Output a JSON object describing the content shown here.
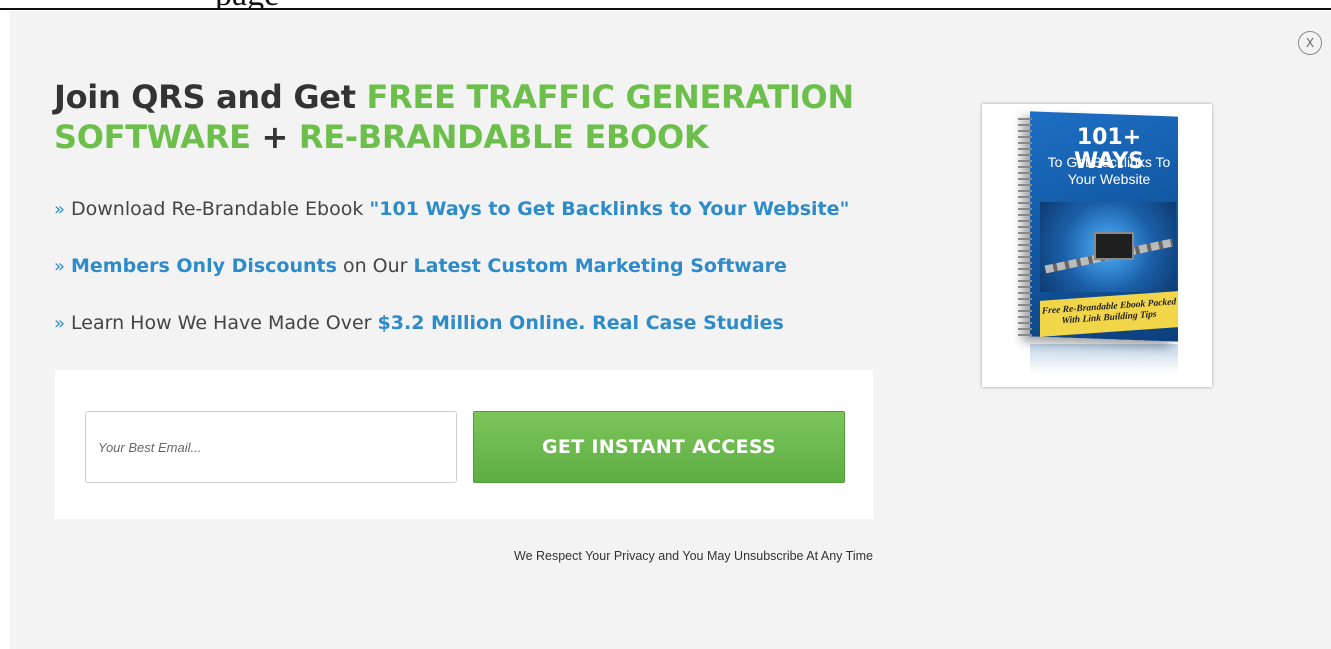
{
  "background": {
    "partial_text": "                                   page"
  },
  "popup": {
    "close_label": "X",
    "headline": {
      "part1": "Join QRS and Get ",
      "part2": "FREE TRAFFIC GENERATION SOFTWARE",
      "part3": " + ",
      "part4": "RE-BRANDABLE EBOOK"
    },
    "bullets": [
      {
        "arrow": "»",
        "pre": "Download Re-Brandable Ebook ",
        "highlight": "\"101 Ways to Get Backlinks to Your Website\"",
        "post": ""
      },
      {
        "arrow": "»",
        "pre": "",
        "highlight": "Members Only Discounts",
        "mid": " on Our ",
        "highlight2": "Latest Custom Marketing Software"
      },
      {
        "arrow": "»",
        "pre": "Learn How We Have Made Over ",
        "highlight": "$3.2 Million Online. Real Case Studies",
        "post": ""
      }
    ],
    "form": {
      "email_placeholder": "Your Best Email...",
      "email_value": "",
      "submit_label": "GET INSTANT ACCESS"
    },
    "privacy_text": "We Respect Your Privacy and You May Unsubscribe At Any Time",
    "ebook": {
      "title": "101+ WAYS",
      "subtitle": "To Get Backlinks To Your Website",
      "banner": "Free Re-Brandable Ebook Packed With Link Building Tips"
    },
    "colors": {
      "accent_green": "#6cbf4a",
      "accent_blue": "#2e8bc9",
      "button_green": "#5eae43",
      "background": "#f3f3f3"
    }
  }
}
